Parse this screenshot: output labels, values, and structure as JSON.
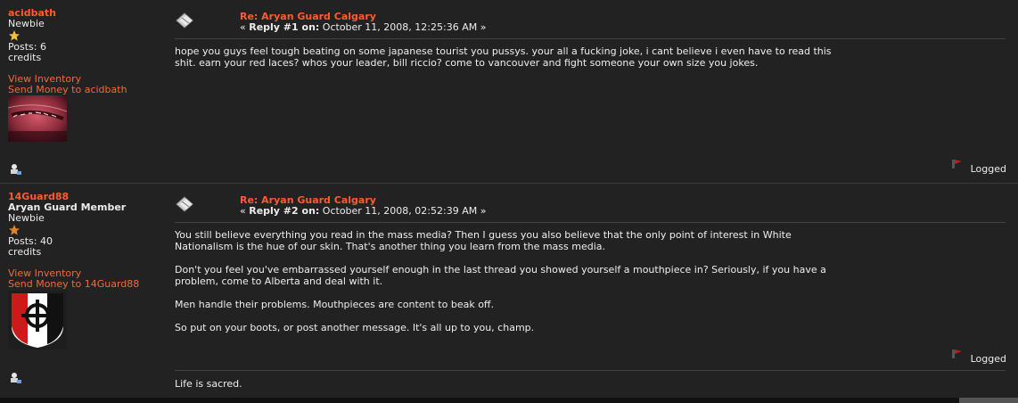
{
  "posts": [
    {
      "user": {
        "name": "acidbath",
        "title": "",
        "rank": "Newbie",
        "posts_label": "Posts: 6",
        "credits_label": "credits",
        "view_inventory": "View Inventory",
        "send_money": "Send Money to acidbath"
      },
      "subject": "Re: Aryan Guard Calgary",
      "meta_prefix": "« ",
      "reply_label": "Reply #1 on:",
      "date": " October 11, 2008, 12:25:36 AM »",
      "body": [
        "hope you guys feel tough beating on some japanese tourist you pussys. your all a fucking joke, i cant believe i even have to read this shit. earn your red laces? whos your leader, bill riccio? come to vancouver and fight someone your own size you jokes."
      ],
      "logged": "Logged",
      "signature": ""
    },
    {
      "user": {
        "name": "14Guard88",
        "title": "Aryan Guard Member",
        "rank": "Newbie",
        "posts_label": "Posts: 40",
        "credits_label": "credits",
        "view_inventory": "View Inventory",
        "send_money": "Send Money to 14Guard88"
      },
      "subject": "Re: Aryan Guard Calgary",
      "meta_prefix": "« ",
      "reply_label": "Reply #2 on:",
      "date": " October 11, 2008, 02:52:39 AM »",
      "body": [
        "You still believe everything you read in the mass media? Then I guess you also believe that the only point of interest in White Nationalism is the hue of our skin. That's another thing you learn from the mass media.",
        "Don't you feel you've embarrassed yourself enough in the last thread you showed yourself a mouthpiece in? Seriously, if you have a problem, come to Alberta and deal with it.",
        "Men handle their problems. Mouthpieces are content to beak off.",
        "So put on your boots, or post another message. It's all up to you, champ."
      ],
      "logged": "Logged",
      "signature": "Life is sacred."
    }
  ],
  "colors": {
    "accent": "#ff5a30",
    "background": "#222222"
  },
  "icons": [
    "post-icon",
    "star-icon",
    "profile-icon",
    "report-icon"
  ]
}
